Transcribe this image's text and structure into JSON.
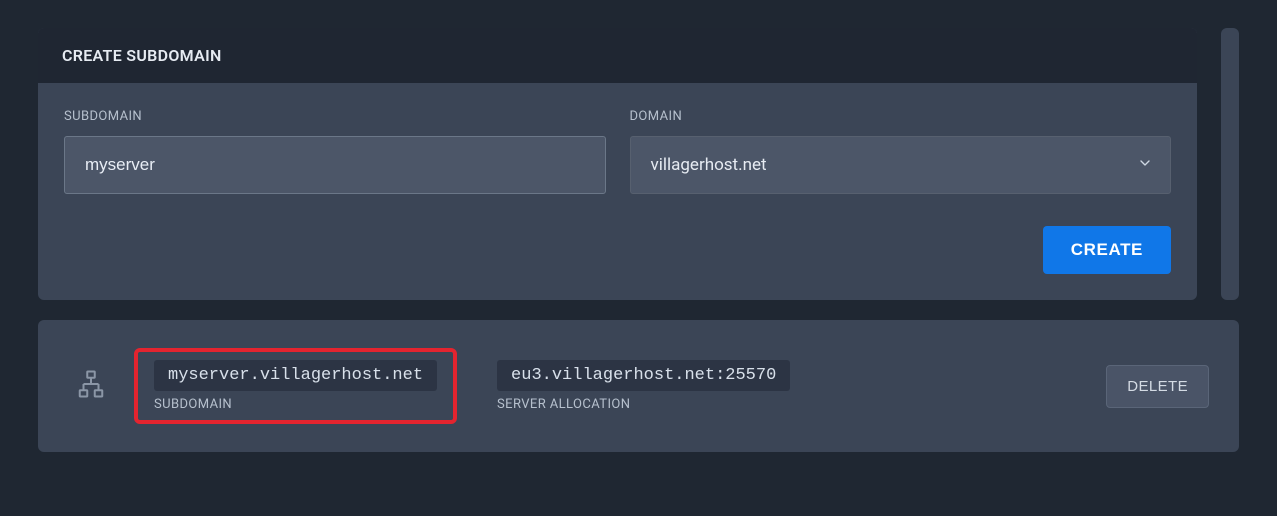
{
  "create_card": {
    "header": "CREATE SUBDOMAIN",
    "fields": {
      "subdomain": {
        "label": "SUBDOMAIN",
        "value": "myserver"
      },
      "domain": {
        "label": "DOMAIN",
        "selected": "villagerhost.net"
      }
    },
    "create_button": "CREATE"
  },
  "entry": {
    "subdomain_value": "myserver.villagerhost.net",
    "subdomain_label": "SUBDOMAIN",
    "allocation_value": "eu3.villagerhost.net:25570",
    "allocation_label": "SERVER ALLOCATION",
    "delete_button": "DELETE"
  }
}
